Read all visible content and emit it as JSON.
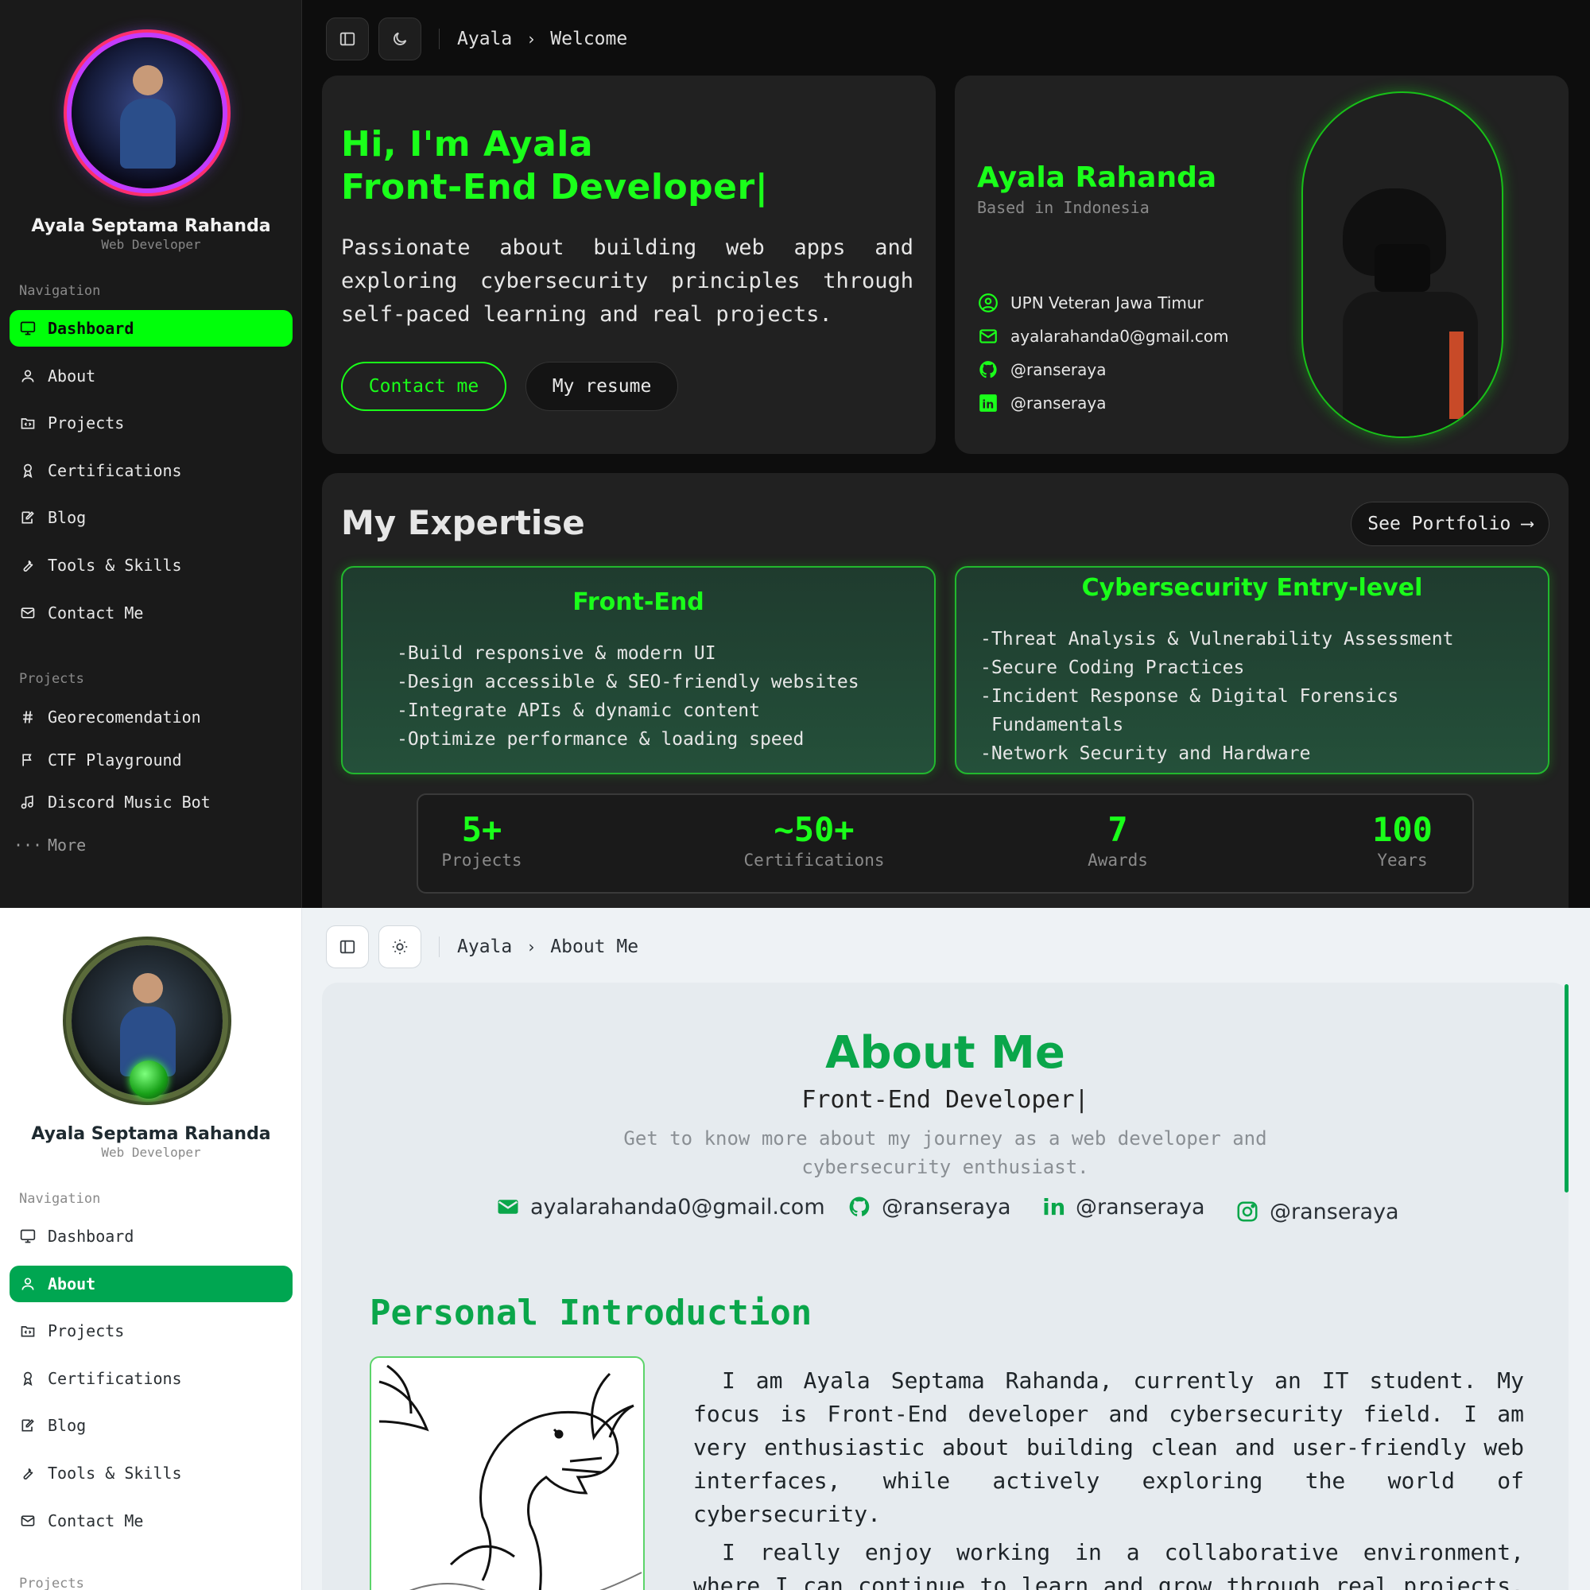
{
  "profile": {
    "name": "Ayala Septama Rahanda",
    "role": "Web Developer"
  },
  "nav": {
    "section_navigation": "Navigation",
    "section_projects": "Projects",
    "items": [
      "Dashboard",
      "About",
      "Projects",
      "Certifications",
      "Blog",
      "Tools & Skills",
      "Contact Me"
    ],
    "projects": [
      "Georecomendation",
      "CTF Playground",
      "Discord Music Bot",
      "More"
    ]
  },
  "dark": {
    "breadcrumb": {
      "root": "Ayala",
      "current": "Welcome"
    },
    "hero": {
      "line1": "Hi, I'm Ayala",
      "line2": "Front-End Developer|",
      "description": "Passionate about building web apps and exploring cybersecurity principles through self-paced learning and real projects.",
      "contact_button": "Contact me",
      "resume_button": "My resume"
    },
    "profile_card": {
      "name": "Ayala Rahanda",
      "location": "Based in Indonesia",
      "university": "UPN Veteran Jawa Timur",
      "email": "ayalarahanda0@gmail.com",
      "github": "@ranseraya",
      "linkedin": "@ranseraya"
    },
    "expertise": {
      "title": "My Expertise",
      "see_portfolio": "See Portfolio ⟶",
      "frontend": {
        "title": "Front-End",
        "items": [
          "-Build responsive & modern UI",
          "-Design accessible & SEO-friendly websites",
          "-Integrate APIs & dynamic content",
          "-Optimize performance & loading speed"
        ]
      },
      "cyber": {
        "title": "Cybersecurity Entry-level",
        "items": [
          "-Threat Analysis & Vulnerability Assessment",
          "-Secure Coding Practices",
          "-Incident Response & Digital Forensics",
          " Fundamentals",
          "-Network Security and Hardware"
        ]
      }
    },
    "stats": [
      {
        "value": "5+",
        "label": "Projects"
      },
      {
        "value": "~50+",
        "label": "Certifications"
      },
      {
        "value": "7",
        "label": "Awards"
      },
      {
        "value": "100",
        "label": "Years"
      }
    ]
  },
  "light": {
    "breadcrumb": {
      "root": "Ayala",
      "current": "About Me"
    },
    "about": {
      "title": "About Me",
      "subtitle": "Front-End Developer|",
      "lead": "Get to know more about my journey as a web developer and cybersecurity enthusiast.",
      "email": "ayalarahanda0@gmail.com",
      "github": "@ranseraya",
      "linkedin": "@ranseraya",
      "instagram": "@ranseraya"
    },
    "intro": {
      "title": "Personal Introduction",
      "p1": "I am Ayala Septama Rahanda, currently an IT student. My focus is Front-End developer and cybersecurity field. I am very enthusiastic about building clean and user-friendly web interfaces, while actively exploring the world of cybersecurity.",
      "p2": "I really enjoy working in a collaborative environment, where I can continue to learn and grow through real projects. The"
    }
  },
  "colors": {
    "dark_accent": "#1aff1a",
    "light_accent": "#0aa64a"
  }
}
